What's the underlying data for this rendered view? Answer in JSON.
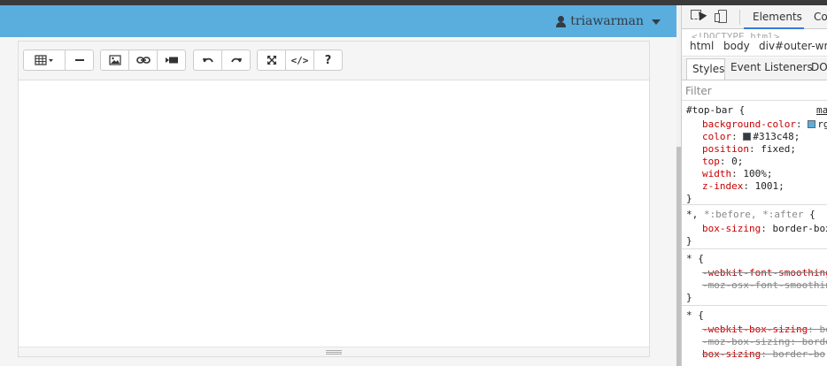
{
  "app": {
    "user": {
      "name": "triawarman",
      "icon": "user-icon",
      "caret": "caret-down-icon"
    },
    "colors": {
      "top_bar": "#5aaedd",
      "text": "#313c48"
    },
    "editor": {
      "toolbar_groups": [
        [
          {
            "name": "table-dropdown-button",
            "icon": "table-icon"
          },
          {
            "name": "horizontal-rule-button",
            "icon": "minus-icon"
          }
        ],
        [
          {
            "name": "insert-image-button",
            "icon": "image-icon"
          },
          {
            "name": "insert-link-button",
            "icon": "link-icon"
          },
          {
            "name": "insert-video-button",
            "icon": "video-icon"
          }
        ],
        [
          {
            "name": "undo-button",
            "icon": "undo-icon"
          },
          {
            "name": "redo-button",
            "icon": "redo-icon"
          }
        ],
        [
          {
            "name": "fullscreen-button",
            "icon": "expand-icon"
          },
          {
            "name": "code-view-button",
            "label": "</>"
          },
          {
            "name": "help-button",
            "label": "?"
          }
        ]
      ]
    }
  },
  "devtools": {
    "tabs": {
      "elements": "Elements",
      "console": "Co"
    },
    "doctype": "<!DOCTYPE html>",
    "breadcrumbs": [
      "html",
      "body",
      "div#outer-wrap"
    ],
    "subtabs": {
      "styles": "Styles",
      "event_listeners": "Event Listeners",
      "dom": "DOM"
    },
    "filter_placeholder": "Filter",
    "rules": [
      {
        "selector": "#top-bar {",
        "source": "ma",
        "props": [
          {
            "name": "background-color",
            "value": "rg",
            "swatch": "#5aaedd"
          },
          {
            "name": "color",
            "value": "#313c48;",
            "swatch": "#313c48"
          },
          {
            "name": "position",
            "value": "fixed;"
          },
          {
            "name": "top",
            "value": "0;"
          },
          {
            "name": "width",
            "value": "100%;"
          },
          {
            "name": "z-index",
            "value": "1001;"
          }
        ]
      },
      {
        "selector_main": "*, ",
        "selector_dim": "*:before, *:after",
        "selector_end": " {",
        "props": [
          {
            "name": "box-sizing",
            "value": "border-box;"
          }
        ]
      },
      {
        "selector": "* {",
        "props": [
          {
            "name": "-webkit-font-smoothing",
            "value": ""
          },
          {
            "name": "-moz-osx-font-smoothin",
            "value": ""
          }
        ]
      },
      {
        "selector": "* {",
        "props": [
          {
            "name": "-webkit-box-sizing",
            "value": "bo"
          },
          {
            "name": "-moz-box-sizing",
            "value": "borde"
          },
          {
            "name": "box-sizing",
            "value": "border-bo"
          }
        ]
      }
    ]
  }
}
